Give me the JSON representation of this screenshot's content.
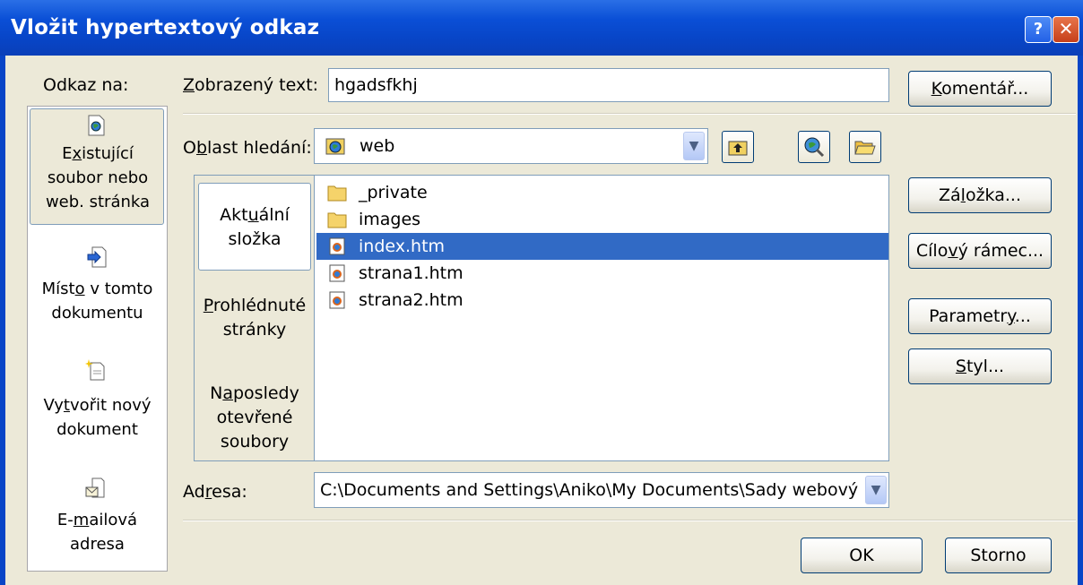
{
  "window": {
    "title": "Vložit hypertextový odkaz",
    "help_glyph": "?",
    "close_glyph": "✕"
  },
  "link_to": {
    "label": "Odkaz na:",
    "items": [
      {
        "line1_pre": "E",
        "line1_u": "x",
        "line1_post": "istující",
        "line2": "soubor nebo",
        "line3": "web. stránka",
        "icon": "web-file-icon"
      },
      {
        "line1_pre": "Míst",
        "line1_u": "o",
        "line1_post": " v tomto",
        "line2": "dokumentu",
        "icon": "place-in-document-icon"
      },
      {
        "line1_pre": "Vy",
        "line1_u": "t",
        "line1_post": "vořit nový",
        "line2": "dokument",
        "icon": "new-document-icon"
      },
      {
        "line1_pre": "E-",
        "line1_u": "m",
        "line1_post": "ailová",
        "line2": "adresa",
        "icon": "email-icon"
      }
    ]
  },
  "display_text": {
    "label_u": "Z",
    "label_rest": "obrazený text:",
    "value": "hgadsfkhj"
  },
  "look_in": {
    "label_pre": "O",
    "label_u": "b",
    "label_post": "last hledání:",
    "value": "web"
  },
  "views": [
    {
      "pre": "Akt",
      "u": "u",
      "post": "ální",
      "line2": "složka"
    },
    {
      "pre": "",
      "u": "P",
      "post": "rohlédnuté",
      "line2": "stránky"
    },
    {
      "pre": "N",
      "u": "a",
      "post": "posledy",
      "line2": "otevřené",
      "line3": "soubory"
    }
  ],
  "files": [
    {
      "name": "_private",
      "icon": "folder-icon",
      "selected": false
    },
    {
      "name": "images",
      "icon": "folder-icon",
      "selected": false
    },
    {
      "name": "index.htm",
      "icon": "html-file-icon",
      "selected": true
    },
    {
      "name": "strana1.htm",
      "icon": "html-file-icon",
      "selected": false
    },
    {
      "name": "strana2.htm",
      "icon": "html-file-icon",
      "selected": false
    }
  ],
  "address": {
    "label_pre": "Ad",
    "label_u": "r",
    "label_post": "esa:",
    "value": "C:\\Documents and Settings\\Aniko\\My Documents\\Sady webový"
  },
  "buttons": {
    "comment": {
      "u": "K",
      "rest": "omentář..."
    },
    "bookmark": {
      "pre": "Zá",
      "u": "l",
      "post": "ožka..."
    },
    "target_frame": {
      "pre": "Cílo",
      "u": "v",
      "post": "ý rámec..."
    },
    "parameters": {
      "pre": "Parametr",
      "u": "y",
      "post": "..."
    },
    "style": {
      "pre": "",
      "u": "S",
      "post": "tyl..."
    },
    "ok": "OK",
    "cancel": "Storno"
  },
  "colors": {
    "titlebar": "#0a4fd6",
    "selection": "#316ac5",
    "face": "#ece9d8"
  }
}
